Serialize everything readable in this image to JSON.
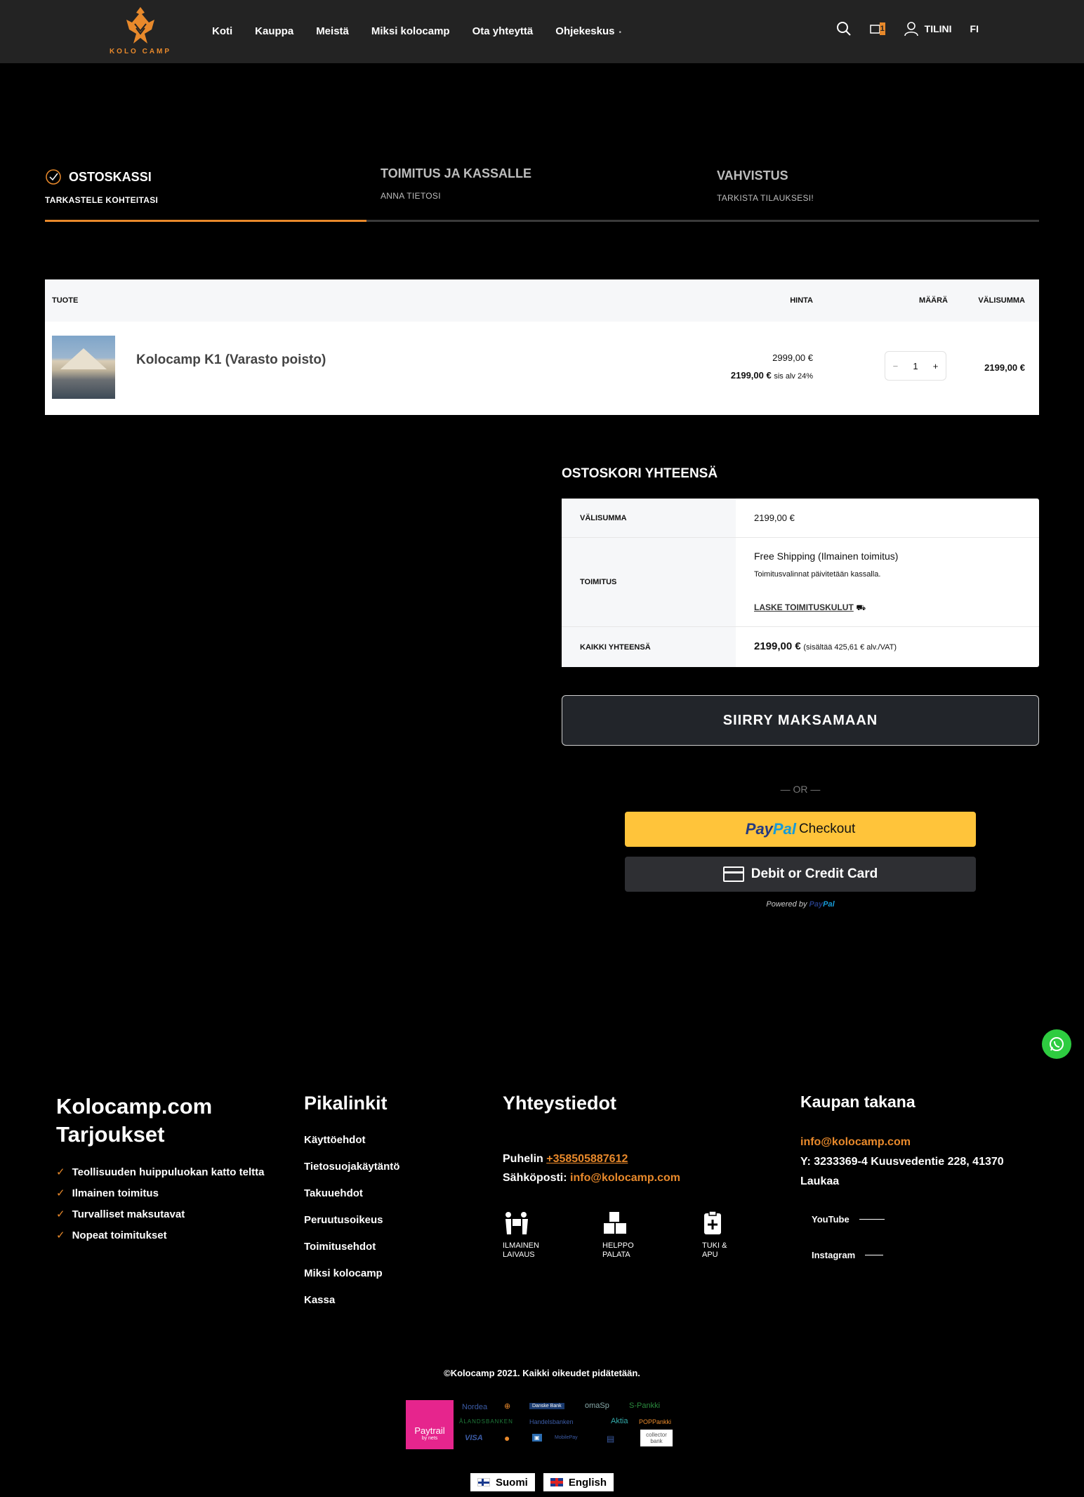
{
  "header": {
    "logo_text": "KOLO CAMP",
    "nav": [
      "Koti",
      "Kauppa",
      "Meistä",
      "Miksi kolocamp",
      "Ota yhteyttä",
      "Ohjekeskus"
    ],
    "cart_count": "1",
    "account_label": "TILINI",
    "lang": "FI"
  },
  "steps": [
    {
      "title": "OSTOSKASSI",
      "subtitle": "TARKASTELE KOHTEITASI"
    },
    {
      "title": "TOIMITUS JA KASSALLE",
      "subtitle": "ANNA TIETOSI"
    },
    {
      "title": "VAHVISTUS",
      "subtitle": "TARKISTA TILAUKSESI!"
    }
  ],
  "cart": {
    "headers": {
      "product": "TUOTE",
      "price": "HINTA",
      "qty": "MÄÄRÄ",
      "subtotal": "VÄLISUMMA"
    },
    "item": {
      "name": "Kolocamp K1 (Varasto poisto)",
      "old_price": "2999,00 €",
      "price": "2199,00 €",
      "tax_note": "sis alv 24%",
      "qty": "1",
      "minus": "−",
      "plus": "+",
      "subtotal": "2199,00 €"
    }
  },
  "totals": {
    "title": "OSTOSKORI YHTEENSÄ",
    "subtotal_label": "VÄLISUMMA",
    "subtotal_value": "2199,00 €",
    "shipping_label": "TOIMITUS",
    "shipping_method": "Free Shipping (Ilmainen toimitus)",
    "shipping_note": "Toimitusvalinnat päivitetään kassalla.",
    "calc_link": "LASKE TOIMITUSKULUT",
    "total_label": "KAIKKI YHTEENSÄ",
    "total_value": "2199,00 €",
    "total_tax": "(sisältää 425,61 € alv./VAT)"
  },
  "checkout_button": "SIIRRY MAKSAMAAN",
  "or_text": "— OR —",
  "paypal": {
    "pay": "Pay",
    "pal": "Pal",
    "checkout": "Checkout",
    "card": "Debit or Credit Card",
    "powered": "Powered by"
  },
  "footer": {
    "col1": {
      "title": "Kolocamp.com Tarjoukset",
      "items": [
        "Teollisuuden huippuluokan katto teltta",
        "Ilmainen toimitus",
        "Turvalliset maksutavat",
        "Nopeat toimitukset"
      ]
    },
    "col2": {
      "title": "Pikalinkit",
      "links": [
        "Käyttöehdot",
        "Tietosuojakäytäntö",
        "Takuuehdot",
        "Peruutusoikeus",
        "Toimitusehdot",
        "Miksi kolocamp",
        "Kassa"
      ]
    },
    "col3": {
      "title": "Yhteystiedot",
      "phone_label": "Puhelin",
      "phone": "+358505887612",
      "email_label": "Sähköposti:",
      "email": "info@kolocamp.com",
      "features": [
        {
          "line1": "ILMAINEN",
          "line2": "LAIVAUS"
        },
        {
          "line1": "HELPPO",
          "line2": "PALATA"
        },
        {
          "line1": "TUKI &",
          "line2": "APU"
        }
      ]
    },
    "col4": {
      "title": "Kaupan takana",
      "email": "info@kolocamp.com",
      "address": "Y: 3233369-4 Kuusvedentie 228, 41370 Laukaa",
      "social": [
        "YouTube",
        "Instagram"
      ]
    },
    "copyright": "©Kolocamp 2021. Kaikki oikeudet pidätetään.",
    "paytrail": "Paytrail",
    "paytrail_sub": "by nets",
    "banks": [
      "Nordea",
      "Danske Bank",
      "omaSp",
      "S-Pankki",
      "ÅLANDSBANKEN",
      "Handelsbanken",
      "Aktia",
      "POPPankki",
      "VISA",
      "MobilePay",
      "collector bank"
    ],
    "languages": [
      "Suomi",
      "English"
    ]
  }
}
